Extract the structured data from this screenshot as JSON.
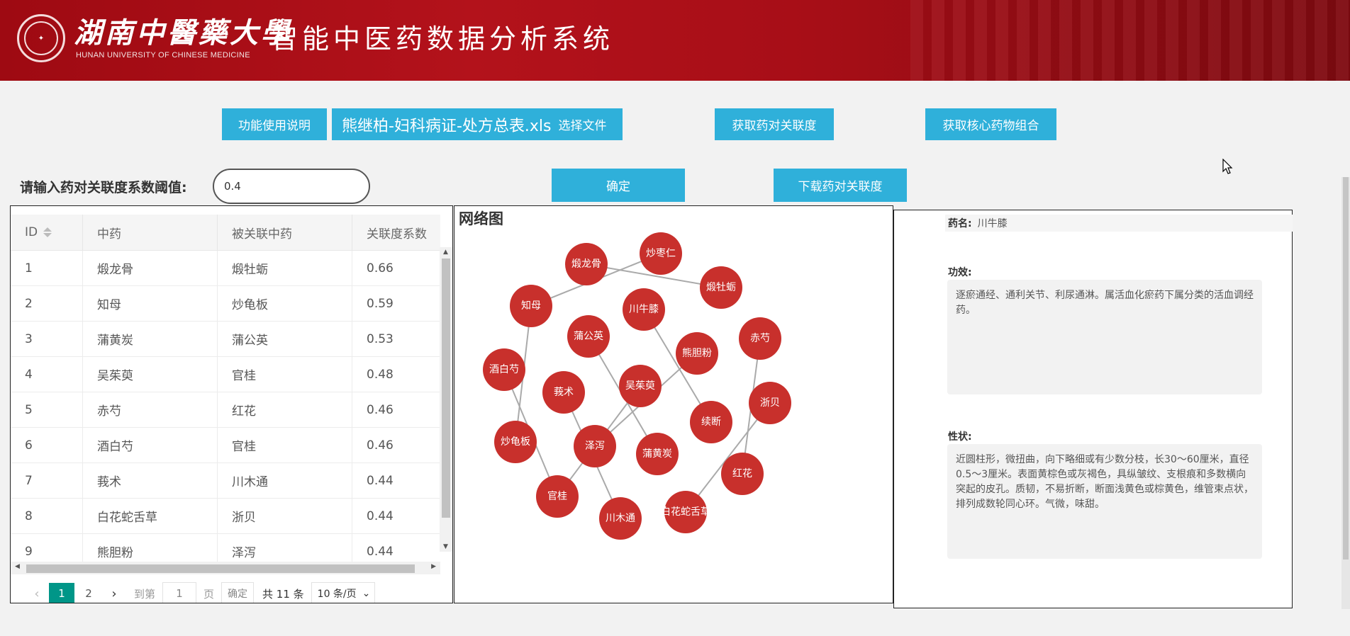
{
  "header": {
    "university_cn": "湖南中醫藥大學",
    "university_en": "HUNAN UNIVERSITY OF CHINESE MEDICINE",
    "system_title": "智能中医药数据分析系统"
  },
  "toolbar": {
    "help_label": "功能使用说明",
    "file_name": "熊继柏-妇科病证-处方总表.xls",
    "choose_file_label": "选择文件",
    "get_pair_label": "获取药对关联度",
    "get_core_label": "获取核心药物组合",
    "confirm_label": "确定",
    "download_label": "下载药对关联度"
  },
  "threshold": {
    "label": "请输入药对关联度系数阈值:",
    "value": "0.4"
  },
  "table": {
    "headers": [
      "ID",
      "中药",
      "被关联中药",
      "关联度系数"
    ],
    "rows": [
      [
        "1",
        "煅龙骨",
        "煅牡蛎",
        "0.66"
      ],
      [
        "2",
        "知母",
        "炒龟板",
        "0.59"
      ],
      [
        "3",
        "蒲黄炭",
        "蒲公英",
        "0.53"
      ],
      [
        "4",
        "吴茱萸",
        "官桂",
        "0.48"
      ],
      [
        "5",
        "赤芍",
        "红花",
        "0.46"
      ],
      [
        "6",
        "酒白芍",
        "官桂",
        "0.46"
      ],
      [
        "7",
        "莪术",
        "川木通",
        "0.44"
      ],
      [
        "8",
        "白花蛇舌草",
        "浙贝",
        "0.44"
      ],
      [
        "9",
        "熊胆粉",
        "泽泻",
        "0.44"
      ]
    ]
  },
  "pagination": {
    "pages": [
      "1",
      "2"
    ],
    "goto_label": "到第",
    "goto_value": "1",
    "page_unit": "页",
    "ok_label": "确定",
    "total_label": "共 11 条",
    "page_size": "10 条/页"
  },
  "network": {
    "title": "网络图",
    "node_color": "#c8302c",
    "edge_color": "#aaaaaa",
    "nodes": [
      "煅龙骨",
      "炒枣仁",
      "煅牡蛎",
      "知母",
      "川牛膝",
      "蒲公英",
      "赤芍",
      "熊胆粉",
      "酒白芍",
      "莪术",
      "吴茱萸",
      "浙贝",
      "续断",
      "炒龟板",
      "泽泻",
      "蒲黄炭",
      "红花",
      "官桂",
      "白花蛇舌草",
      "川木通"
    ],
    "edges": [
      [
        "煅龙骨",
        "煅牡蛎"
      ],
      [
        "知母",
        "炒枣仁"
      ],
      [
        "知母",
        "炒龟板"
      ],
      [
        "川牛膝",
        "续断"
      ],
      [
        "蒲公英",
        "蒲黄炭"
      ],
      [
        "赤芍",
        "红花"
      ],
      [
        "熊胆粉",
        "泽泻"
      ],
      [
        "酒白芍",
        "官桂"
      ],
      [
        "莪术",
        "川木通"
      ],
      [
        "吴茱萸",
        "官桂"
      ],
      [
        "浙贝",
        "白花蛇舌草"
      ]
    ]
  },
  "herb_info": {
    "name_label": "药名:",
    "name_value": "川牛膝",
    "efficacy_label": "功效:",
    "efficacy_text": "逐瘀通经、通利关节、利尿通淋。属活血化瘀药下属分类的活血调经药。",
    "property_label": "性状:",
    "property_text": "近圆柱形，微扭曲，向下略细或有少数分枝，长30～60厘米，直径0.5～3厘米。表面黄棕色或灰褐色，具纵皱纹、支根痕和多数横向突起的皮孔。质韧，不易折断，断面浅黄色或棕黄色，维管束点状，排列成数轮同心环。气微，味甜。"
  },
  "colors": {
    "header_red": "#a70e17",
    "button_blue": "#2fb0da",
    "pager_active": "#009688"
  }
}
